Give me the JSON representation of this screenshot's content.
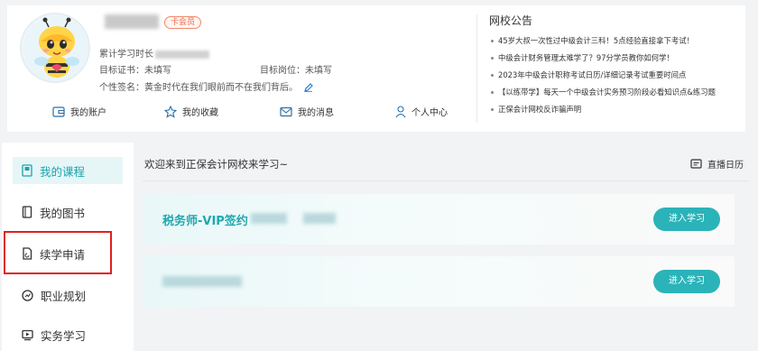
{
  "profile": {
    "member_badge": "卡会员",
    "study_time_label": "累计学习时长",
    "target_cert_label": "目标证书：",
    "target_cert_value": "未填写",
    "target_post_label": "目标岗位：",
    "target_post_value": "未填写",
    "signature_label": "个性签名：",
    "signature_value": "黄金时代在我们眼前而不在我们背后。"
  },
  "quick_links": [
    {
      "label": "我的账户",
      "icon": "wallet-icon"
    },
    {
      "label": "我的收藏",
      "icon": "star-icon"
    },
    {
      "label": "我的消息",
      "icon": "mail-icon"
    },
    {
      "label": "个人中心",
      "icon": "user-icon"
    }
  ],
  "notices": {
    "title": "网校公告",
    "items": [
      "45岁大叔一次性过中级会计三科！5点经验直接拿下考试！",
      "中级会计财务管理太难学了？97分学员教你如何学！",
      "2023年中级会计职称考试日历/详细记录考试重要时间点",
      "【以练带学】每天一个中级会计实务预习阶段必看知识点&练习题",
      "正保会计网校反诈骗声明"
    ]
  },
  "sidebar": {
    "items": [
      {
        "label": "我的课程",
        "icon": "course-icon"
      },
      {
        "label": "我的图书",
        "icon": "book-icon"
      },
      {
        "label": "续学申请",
        "icon": "renew-icon"
      },
      {
        "label": "职业规划",
        "icon": "plan-icon"
      },
      {
        "label": "实务学习",
        "icon": "practice-icon"
      }
    ]
  },
  "main": {
    "welcome": "欢迎来到正保会计网校来学习~",
    "live_calendar": "直播日历",
    "courses": [
      {
        "title": "税务师-VIP签约",
        "button": "进入学习"
      },
      {
        "title": "",
        "button": "进入学习"
      }
    ]
  },
  "colors": {
    "accent": "#2ab3b8",
    "highlight": "#e02020"
  }
}
